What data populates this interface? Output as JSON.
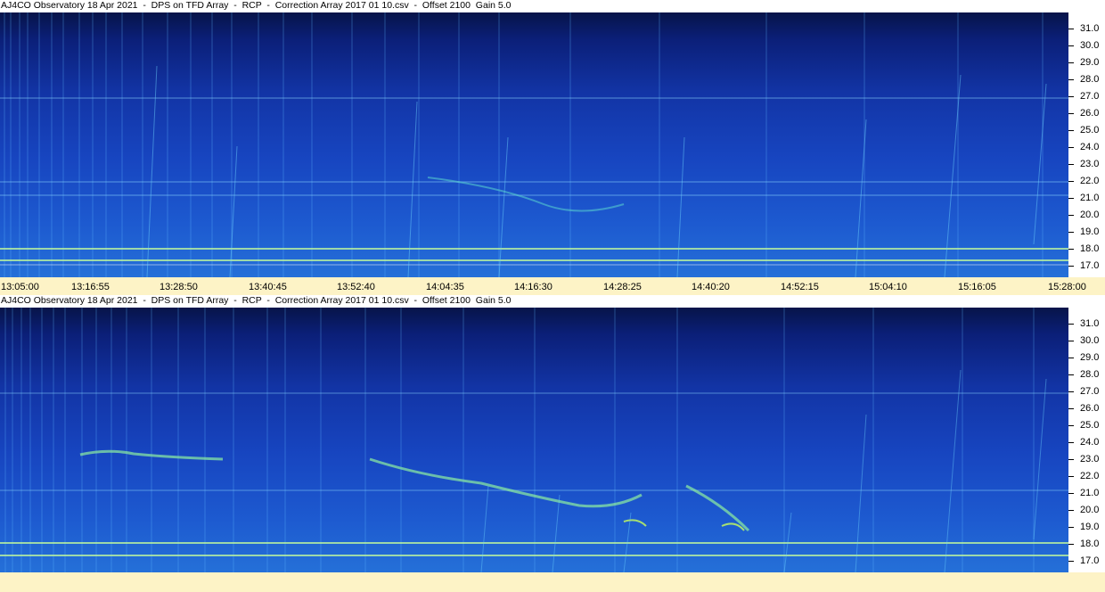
{
  "panels": [
    {
      "title": "AJ4CO Observatory 18 Apr 2021  -  DPS on TFD Array  -  RCP  -  Correction Array 2017 01 10.csv  -  Offset 2100  Gain 5.0",
      "frequency_labels": [
        "31.0",
        "30.0",
        "29.0",
        "28.0",
        "27.0",
        "26.0",
        "25.0",
        "24.0",
        "23.0",
        "22.0",
        "21.0",
        "20.0",
        "19.0",
        "18.0",
        "17.0"
      ],
      "time_labels": [
        "13:05:00",
        "13:16:55",
        "13:28:50",
        "13:40:45",
        "13:52:40",
        "14:04:35",
        "14:16:30",
        "14:28:25",
        "14:40:20",
        "14:52:15",
        "15:04:10",
        "15:16:05",
        "15:28:00"
      ]
    },
    {
      "title": "AJ4CO Observatory 18 Apr 2021  -  DPS on TFD Array  -  RCP  -  Correction Array 2017 01 10.csv  -  Offset 2100  Gain 5.0",
      "frequency_labels": [
        "31.0",
        "30.0",
        "29.0",
        "28.0",
        "27.0",
        "26.0",
        "25.0",
        "24.0",
        "23.0",
        "22.0",
        "21.0",
        "20.0",
        "19.0",
        "18.0",
        "17.0"
      ],
      "time_labels": []
    }
  ],
  "colors": {
    "background": "#ffffff",
    "axis_strip": "#fdf3c6",
    "spectrogram_dark": "#071449",
    "spectrogram_mid": "#1745c0",
    "spectrogram_bright": "#2570d8",
    "emission": "#8ff0a0"
  }
}
